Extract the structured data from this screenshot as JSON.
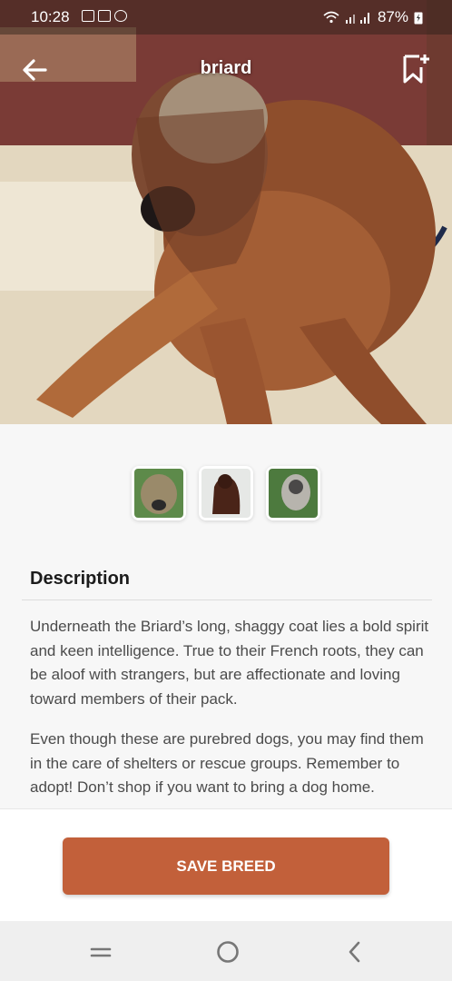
{
  "status_bar": {
    "time": "10:28",
    "battery": "87%"
  },
  "header": {
    "title": "briard",
    "back_icon": "arrow-left-icon",
    "bookmark_icon": "bookmark-add-icon"
  },
  "gallery": {
    "thumbnail_count": 3
  },
  "description": {
    "heading": "Description",
    "paragraphs": [
      "Underneath the Briard’s long, shaggy coat lies a bold spirit and keen intelligence. True to their French roots, they can be aloof with strangers, but are affectionate and loving toward members of their pack.",
      "Even though these are purebred dogs, you may find them in the care of shelters or rescue groups. Remember to adopt! Don’t shop if you want to bring a dog home."
    ]
  },
  "action": {
    "save_label": "SAVE BREED",
    "color": "#c2603a"
  },
  "nav_bar": {
    "recent_icon": "recent-apps-icon",
    "home_icon": "home-circle-icon",
    "back_icon": "chevron-left-icon"
  }
}
